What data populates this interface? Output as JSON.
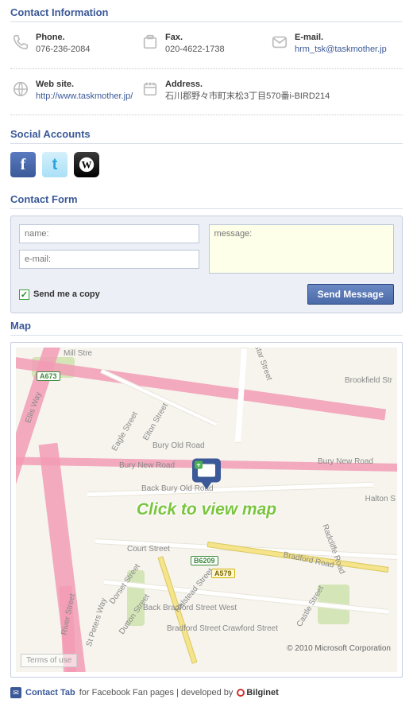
{
  "sections": {
    "contact_info": "Contact Information",
    "social": "Social Accounts",
    "form": "Contact Form",
    "map": "Map"
  },
  "contacts": {
    "phone": {
      "label": "Phone.",
      "value": "076-236-2084"
    },
    "fax": {
      "label": "Fax.",
      "value": "020-4622-1738"
    },
    "email": {
      "label": "E-mail.",
      "value": "hrm_tsk@taskmother.jp"
    },
    "web": {
      "label": "Web site.",
      "value": "http://www.taskmother.jp/"
    },
    "address": {
      "label": "Address.",
      "value": "石川郡野々市町末松3丁目570番i-BIRD214"
    }
  },
  "social": {
    "facebook": "facebook",
    "twitter": "twitter",
    "wordpress": "wordpress"
  },
  "form": {
    "name_placeholder": "name:",
    "email_placeholder": "e-mail:",
    "message_placeholder": "message:",
    "copy_label": "Send me a copy",
    "send_label": "Send Message"
  },
  "map": {
    "click_text": "Click to view map",
    "copyright": "© 2010 Microsoft Corporation",
    "terms": "Terms of use",
    "roads": {
      "mill": "Mill Stre",
      "kostar": "Kostar Street",
      "brookfield": "Brookfield Str",
      "ellis": "Ellis Way",
      "eagle": "Eagle Street",
      "elton": "Elton Street",
      "buryold": "Bury Old Road",
      "burynew1": "Bury New Road",
      "burynew2": "Bury New Road",
      "backburyold": "Back Bury Old Road",
      "halton": "Halton S",
      "court": "Court Street",
      "dorset": "Dorset Street",
      "dutton": "Dutton Street",
      "halstead": "Halstead Street",
      "backbradw": "Back Bradford Street West",
      "bradford": "Bradford Street",
      "crawford": "Crawford Street",
      "bradfordrd": "Bradford Road",
      "radcliffe": "Radcliffe Road",
      "castle": "Castle Street",
      "river": "River Street",
      "stpeters": "St Peters Way",
      "a673": "A673",
      "b6209": "B6209",
      "a579": "A579"
    }
  },
  "footer": {
    "product": "Contact Tab",
    "text1": "for Facebook Fan pages | developed by",
    "dev": "Bilginet"
  }
}
